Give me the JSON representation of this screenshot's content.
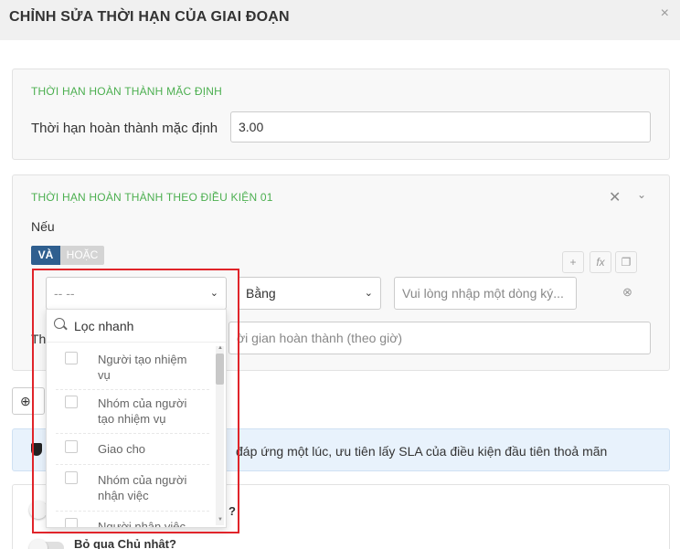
{
  "header": {
    "title": "CHỈNH SỬA THỜI HẠN CỦA GIAI ĐOẠN",
    "close_icon": "×"
  },
  "default_section": {
    "title": "THỜI HẠN HOÀN THÀNH MẶC ĐỊNH",
    "label": "Thời hạn hoàn thành mặc định",
    "value": "3.00"
  },
  "condition_section": {
    "title": "THỜI HẠN HOÀN THÀNH THEO ĐIỀU KIỆN 01",
    "if_label": "Nếu",
    "and_label": "VÀ",
    "or_label": "HOẶC",
    "field_select": "-- --",
    "operator_select": "Bằng",
    "value_placeholder": "Vui lòng nhập một dòng ký...",
    "deadline_label_partial": "Th",
    "deadline_placeholder_partial": "ời gian hoàn thành (theo giờ)"
  },
  "info": {
    "text": "đáp ứng một lúc, ưu tiên lấy SLA của điều kiện đầu tiên thoả mãn"
  },
  "toggles": [
    {
      "label": "?"
    },
    {
      "label": "Bỏ qua Chủ nhật?"
    }
  ],
  "dropdown": {
    "search_placeholder": "Lọc nhanh",
    "items": [
      "Người tạo nhiệm vụ",
      "Nhóm của người tạo nhiệm vụ",
      "Giao cho",
      "Nhóm của người nhận việc",
      "Người nhân việc giai"
    ]
  },
  "colors": {
    "accent_green": "#4caf50",
    "and_blue": "#2f5f8f",
    "highlight_red": "#e0242a"
  }
}
